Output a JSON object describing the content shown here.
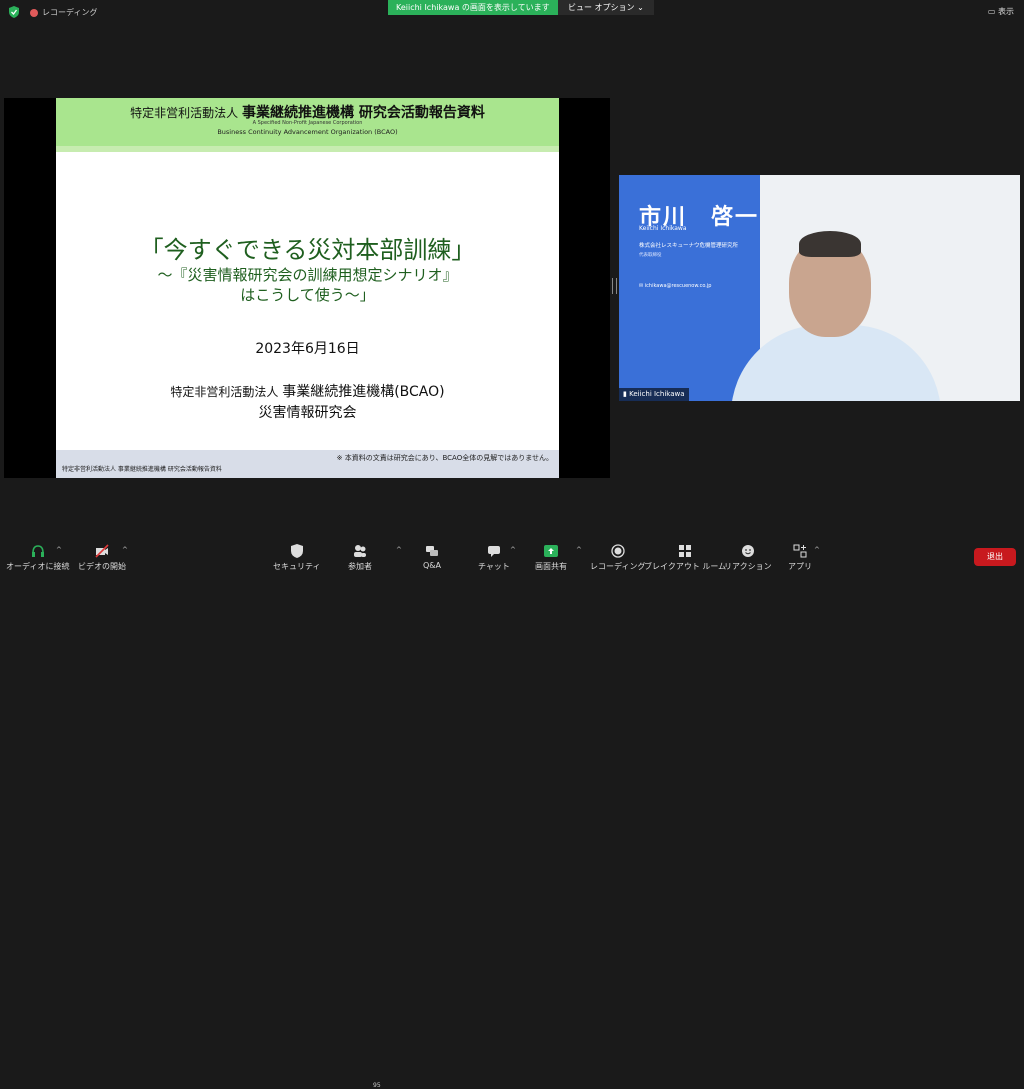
{
  "top_bar": {
    "recording_label": "レコーディング",
    "share_banner": "Keiichi Ichikawa の画面を表示しています",
    "view_options": "ビュー オプション",
    "display_button": "表示"
  },
  "slide": {
    "header_line1_small": "特定非営利活動法人",
    "header_line1_big": "事業継続推進機構 研究会活動報告資料",
    "header_line2": "A Specified Non-Profit Japanese Corporation",
    "header_line3": "Business Continuity Advancement Organization (BCAO)",
    "title": "「今すぐできる災対本部訓練」",
    "subtitle1": "～『災害情報研究会の訓練用想定シナリオ』",
    "subtitle2": "はこうして使う～」",
    "date": "2023年6月16日",
    "org_small": "特定非営利活動法人",
    "org_big": "事業継続推進機構(BCAO)",
    "dept": "災害情報研究会",
    "footer_note": "※ 本資料の文責は研究会にあり、BCAO全体の見解ではありません。",
    "footer_left": "特定非営利活動法人 事業継続推進機構 研究会活動報告資料"
  },
  "video": {
    "name": "市川　啓一",
    "name_roman": "Keiichi Ichikawa",
    "company": "株式会社レスキューナウ危機管理研究所",
    "role": "代表取締役",
    "email": "ichikawa@rescuenow.co.jp",
    "participant_label": "Keiichi Ichikawa"
  },
  "toolbar": {
    "audio": "オーディオに接続",
    "video": "ビデオの開始",
    "security": "セキュリティ",
    "participants": "参加者",
    "participants_count": "95",
    "qa": "Q&A",
    "chat": "チャット",
    "share": "画面共有",
    "record": "レコーディング",
    "breakout": "ブレイクアウト ルーム",
    "reactions": "リアクション",
    "apps": "アプリ",
    "leave": "退出"
  },
  "colors": {
    "slide_header": "#a9e58e",
    "share_green": "#2bb15a",
    "video_blue": "#3a70d8",
    "leave_red": "#c8191e"
  }
}
